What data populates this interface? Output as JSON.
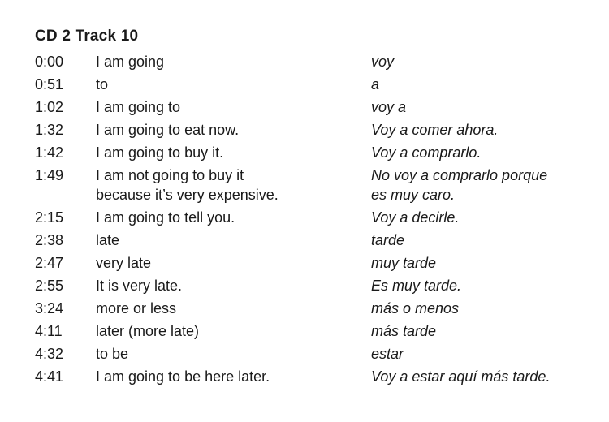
{
  "heading": "CD 2 Track 10",
  "rows": [
    {
      "time": "0:00",
      "english": [
        "I am going"
      ],
      "spanish": [
        "voy"
      ]
    },
    {
      "time": "0:51",
      "english": [
        "to"
      ],
      "spanish": [
        "a"
      ]
    },
    {
      "time": "1:02",
      "english": [
        "I am going to"
      ],
      "spanish": [
        "voy a"
      ]
    },
    {
      "time": "1:32",
      "english": [
        "I am going to eat now."
      ],
      "spanish": [
        "Voy a comer ahora."
      ]
    },
    {
      "time": "1:42",
      "english": [
        "I am going to buy it."
      ],
      "spanish": [
        "Voy a comprarlo."
      ]
    },
    {
      "time": "1:49",
      "english": [
        "I am not going to buy it",
        "because it’s very expensive."
      ],
      "spanish": [
        "No voy a comprarlo porque",
        "es muy caro."
      ]
    },
    {
      "time": "2:15",
      "english": [
        "I am going to tell you."
      ],
      "spanish": [
        "Voy a decirle."
      ]
    },
    {
      "time": "2:38",
      "english": [
        "late"
      ],
      "spanish": [
        "tarde"
      ]
    },
    {
      "time": "2:47",
      "english": [
        "very late"
      ],
      "spanish": [
        "muy tarde"
      ]
    },
    {
      "time": "2:55",
      "english": [
        "It is very late."
      ],
      "spanish": [
        "Es muy tarde."
      ]
    },
    {
      "time": "3:24",
      "english": [
        "more or less"
      ],
      "spanish": [
        "más o menos"
      ]
    },
    {
      "time": "4:11",
      "english": [
        "later (more late)"
      ],
      "spanish": [
        "más tarde"
      ]
    },
    {
      "time": "4:32",
      "english": [
        "to be"
      ],
      "spanish": [
        "estar"
      ]
    },
    {
      "time": "4:41",
      "english": [
        "I am going to be here later."
      ],
      "spanish": [
        "Voy a estar aquí más tarde."
      ]
    }
  ]
}
